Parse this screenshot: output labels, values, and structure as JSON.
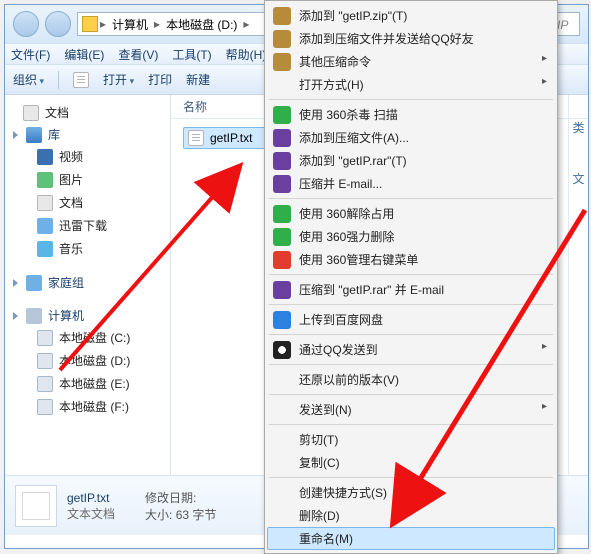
{
  "breadcrumb": {
    "root": "计算机",
    "drive": "本地磁盘 (D:)"
  },
  "search_hint": "搜 getIP",
  "menu": {
    "file": "文件(F)",
    "edit": "编辑(E)",
    "view": "查看(V)",
    "tools": "工具(T)",
    "help": "帮助(H)"
  },
  "toolbar": {
    "org": "组织",
    "open": "打开",
    "print": "打印",
    "new": "新建"
  },
  "sidebar": {
    "doc": "文档",
    "lib_hdr": "库",
    "lib": [
      "视频",
      "图片",
      "文档",
      "迅雷下载",
      "音乐"
    ],
    "homegroup": "家庭组",
    "computer": "计算机",
    "drives": [
      "本地磁盘 (C:)",
      "本地磁盘 (D:)",
      "本地磁盘 (E:)",
      "本地磁盘 (F:)"
    ]
  },
  "content": {
    "col_name": "名称",
    "file": "getIP.txt",
    "side_letters": [
      "类",
      "文"
    ]
  },
  "details": {
    "filename": "getIP.txt",
    "kind": "文本文档",
    "mdate_lbl": "修改日期:",
    "mdate_val": "",
    "size_lbl": "大小:",
    "size_val": "63 字节"
  },
  "ctx": {
    "items": [
      {
        "icon": "zip",
        "label": "添加到 \"getIP.zip\"(T)"
      },
      {
        "icon": "zip",
        "label": "添加到压缩文件并发送给QQ好友"
      },
      {
        "icon": "zip",
        "label": "其他压缩命令",
        "sub": true
      },
      {
        "icon": "blank",
        "label": "打开方式(H)",
        "sub": true
      },
      {
        "sep": true
      },
      {
        "icon": "s360",
        "label": "使用 360杀毒 扫描"
      },
      {
        "icon": "rar",
        "label": "添加到压缩文件(A)..."
      },
      {
        "icon": "rar",
        "label": "添加到 \"getIP.rar\"(T)"
      },
      {
        "icon": "rar",
        "label": "压缩并 E-mail..."
      },
      {
        "sep": true
      },
      {
        "icon": "s360",
        "label": "使用 360解除占用"
      },
      {
        "icon": "s360",
        "label": "使用 360强力删除"
      },
      {
        "icon": "q",
        "label": "使用 360管理右键菜单"
      },
      {
        "sep": true
      },
      {
        "icon": "rar",
        "label": "压缩到 \"getIP.rar\" 并 E-mail"
      },
      {
        "sep": true
      },
      {
        "icon": "bd",
        "label": "上传到百度网盘"
      },
      {
        "sep": true
      },
      {
        "icon": "qq",
        "label": "通过QQ发送到",
        "sub": true
      },
      {
        "sep": true
      },
      {
        "icon": "blank",
        "label": "还原以前的版本(V)"
      },
      {
        "sep": true
      },
      {
        "icon": "blank",
        "label": "发送到(N)",
        "sub": true
      },
      {
        "sep": true
      },
      {
        "icon": "blank",
        "label": "剪切(T)"
      },
      {
        "icon": "blank",
        "label": "复制(C)"
      },
      {
        "sep": true
      },
      {
        "icon": "blank",
        "label": "创建快捷方式(S)"
      },
      {
        "icon": "blank",
        "label": "删除(D)"
      },
      {
        "icon": "blank",
        "label": "重命名(M)",
        "hl": true
      }
    ]
  }
}
